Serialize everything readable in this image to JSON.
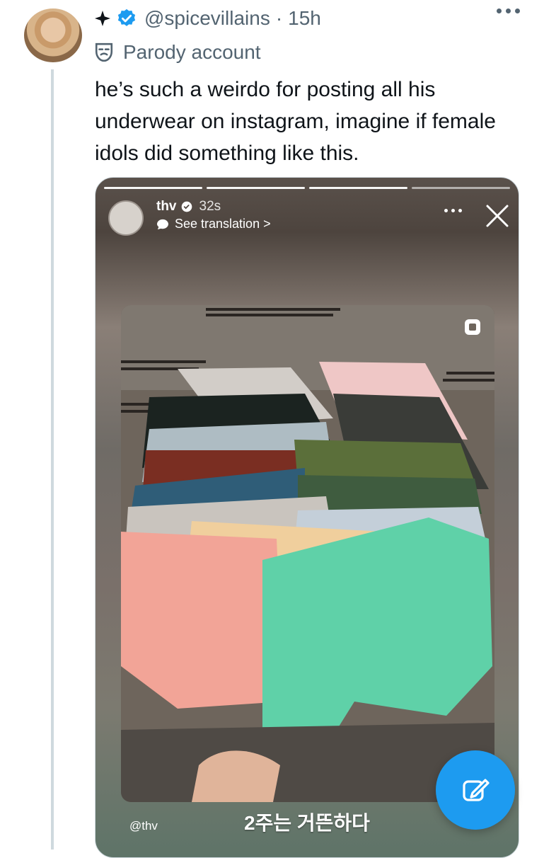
{
  "post": {
    "handle": "@spicevillains",
    "separator": "·",
    "time": "15h",
    "label": "Parody account",
    "text": "he’s such a weirdo for posting all his\nunderwear on instagram, imagine if female\nidols did something like this."
  },
  "story": {
    "username": "thv",
    "time": "32s",
    "translate_label": "See translation >",
    "tag": "@thv",
    "caption": "2주는 거뜬하다"
  },
  "colors": {
    "brand_blue": "#1d9bf0",
    "secondary_text": "#536471",
    "primary_text": "#0f1419"
  },
  "icons": {
    "verified": "verified-badge-icon",
    "parody": "mask-icon",
    "sparkle": "sparkle-icon",
    "compose": "compose-pencil-icon"
  }
}
